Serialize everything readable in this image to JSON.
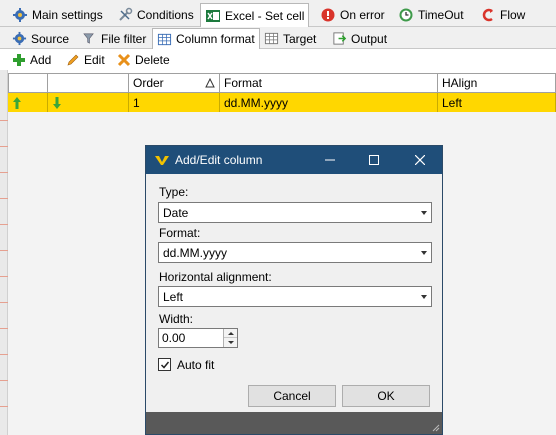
{
  "tabs_main": [
    {
      "label": "Main settings",
      "icon": "gear-icon"
    },
    {
      "label": "Conditions",
      "icon": "tools-icon"
    },
    {
      "label": "Excel - Set cell",
      "icon": "excel-icon",
      "active": true
    },
    {
      "label": "On error",
      "icon": "error-icon"
    },
    {
      "label": "TimeOut",
      "icon": "clock-icon"
    },
    {
      "label": "Flow",
      "icon": "flow-icon"
    }
  ],
  "tabs_sub": [
    {
      "label": "Source",
      "icon": "gear-icon"
    },
    {
      "label": "File filter",
      "icon": "filter-icon"
    },
    {
      "label": "Column format",
      "icon": "table-icon",
      "active": true
    },
    {
      "label": "Target",
      "icon": "table-icon"
    },
    {
      "label": "Output",
      "icon": "output-icon"
    }
  ],
  "toolbar": {
    "add_label": "Add",
    "edit_label": "Edit",
    "delete_label": "Delete"
  },
  "grid": {
    "headers": {
      "order": "Order",
      "format": "Format",
      "halign": "HAlign"
    },
    "rows": [
      {
        "order": "1",
        "format": "dd.MM.yyyy",
        "halign": "Left"
      }
    ]
  },
  "dialog": {
    "title": "Add/Edit column",
    "type_label": "Type:",
    "type_value": "Date",
    "format_label": "Format:",
    "format_value": "dd.MM.yyyy",
    "halign_label": "Horizontal alignment:",
    "halign_value": "Left",
    "width_label": "Width:",
    "width_value": "0.00",
    "autofit_label": "Auto fit",
    "autofit_checked": true,
    "cancel_label": "Cancel",
    "ok_label": "OK"
  },
  "colors": {
    "selected_row": "#ffd700",
    "dialog_title_bg": "#1f4e79",
    "add_green": "#2e9e2e",
    "arrow_green": "#3aa63a"
  }
}
